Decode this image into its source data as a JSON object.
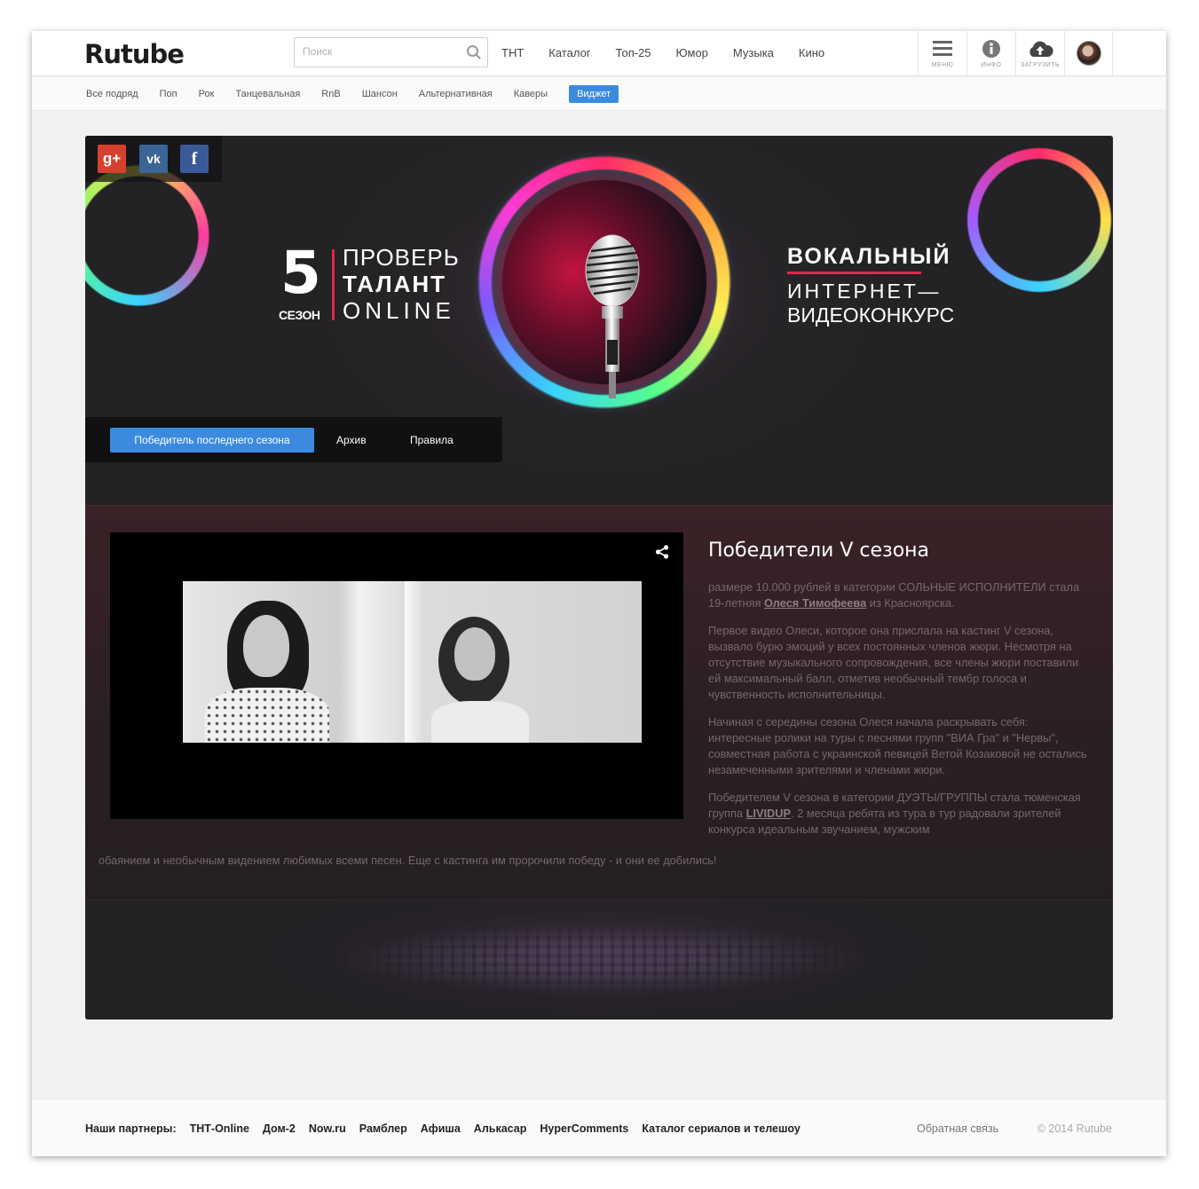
{
  "header": {
    "logo": "Rutube",
    "search_placeholder": "Поиск",
    "nav": [
      "ТНТ",
      "Каталог",
      "Топ-25",
      "Юмор",
      "Музыка",
      "Кино"
    ],
    "tools": {
      "menu": "МЕНЮ",
      "info": "ИНФО",
      "upload": "ЗАГРУЗИТЬ"
    }
  },
  "subnav": {
    "items": [
      "Все подряд",
      "Поп",
      "Рок",
      "Танцевальная",
      "RnB",
      "Шансон",
      "Альтернативная",
      "Каверы"
    ],
    "active": "Виджет"
  },
  "hero": {
    "social": {
      "google": "g+",
      "vk": "vk",
      "facebook": "f"
    },
    "season_number": "5",
    "season_label": "СЕЗОН",
    "line1": "ПРОВЕРЬ",
    "line2": "ТАЛАНТ",
    "line3": "ONLINE",
    "vocal1": "ВОКАЛЬНЫЙ",
    "vocal2": "ИНТЕРНЕТ—",
    "vocal3": "ВИДЕОКОНКУРС",
    "tabs": [
      "Победитель последнего сезона",
      "Архив",
      "Правила"
    ]
  },
  "content": {
    "title": "Победители V сезона",
    "p1_pre": "размере 10.000 рублей в категории СОЛЬНЫЕ ИСПОЛНИТЕЛИ стала 19-летняя ",
    "p1_link": "Олеся Тимофеева",
    "p1_post": " из Красноярска.",
    "p2": "Первое видео Олеси, которое она прислала на кастинг V сезона, вызвало бурю эмоций у всех постоянных членов жюри. Несмотря на отсутствие музыкального сопровождения, все члены жюри поставили ей максимальный балл, отметив необычный тембр голоса и чувственность исполнительницы.",
    "p3": "Начиная с середины сезона Олеся начала раскрывать себя: интересные ролики на туры с песнями групп \"ВИА Гра\" и \"Нервы\", совместная работа с украинской певицей Ветой Козаковой не остались незамеченными зрителями и членами жюри.",
    "p4_pre": "Победителем V сезона в категории ДУЭТЫ/ГРУППЫ стала тюменская группа ",
    "p4_link": "LIVIDUP",
    "p4_post": ". 2 месяца ребята из тура в тур радовали зрителей конкурса идеальным звучанием, мужским",
    "p4_wide": "обаянием и необычным видением любимых всеми песен. Еще с кастинга им пророчили победу - и они ее добились!"
  },
  "footer": {
    "partners_label": "Наши партнеры:",
    "partners": [
      "ТНТ-Online",
      "Дом-2",
      "Now.ru",
      "Рамблер",
      "Афиша",
      "Алькасар",
      "HyperComments",
      "Каталог сериалов и телешоу"
    ],
    "feedback": "Обратная связь",
    "copyright": "© 2014 Rutube"
  },
  "colors": {
    "accent": "#3b8ae0",
    "brand_red": "#e0294b"
  }
}
